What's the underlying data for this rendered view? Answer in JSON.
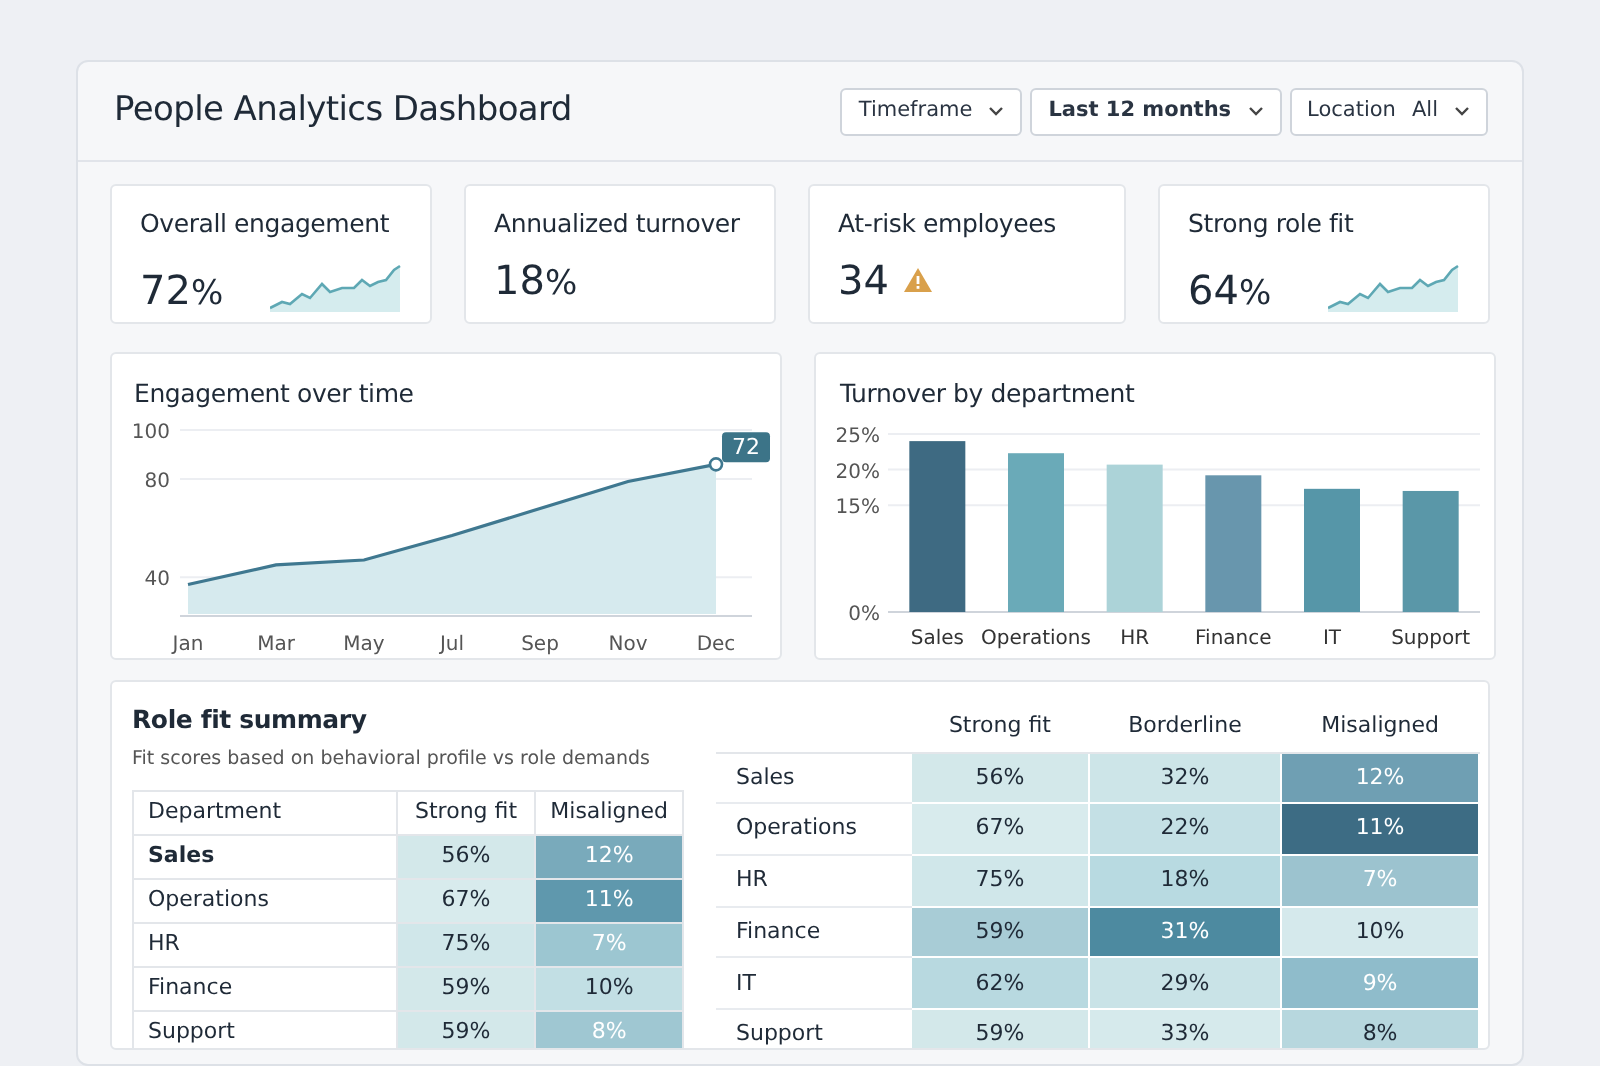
{
  "title": "People Analytics Dashboard",
  "filters": [
    {
      "label": "Timeframe",
      "bold": false
    },
    {
      "label": "Last 12 months",
      "bold": true
    },
    {
      "label": "Location",
      "value": "All",
      "bold": false
    }
  ],
  "kpis": [
    {
      "label": "Overall engagement",
      "value": "72",
      "unit": "%",
      "kind": "sparkline"
    },
    {
      "label": "Annualized turnover",
      "value": "18",
      "unit": "%",
      "kind": "plain"
    },
    {
      "label": "At-risk employees",
      "value": "34",
      "kind": "warning"
    },
    {
      "label": "Strong role fit",
      "value": "64",
      "unit": "%",
      "kind": "sparkline"
    }
  ],
  "engagement_chart": {
    "title": "Engagement over time",
    "chart_data": {
      "type": "area",
      "categories": [
        "Jan",
        "Mar",
        "May",
        "Jul",
        "Sep",
        "Nov",
        "Dec"
      ],
      "ylim": [
        25,
        100
      ],
      "yticks": [
        40,
        80,
        100
      ],
      "series": [
        {
          "color": "#3f7890",
          "values": [
            37,
            45,
            47,
            57,
            68,
            79,
            86
          ]
        }
      ],
      "annotations": [
        {
          "x": "Dec",
          "y": 86,
          "text": "72"
        }
      ]
    }
  },
  "turnover_chart": {
    "title": "Turnover by department",
    "chart_data": {
      "type": "bar",
      "categories": [
        "Sales",
        "Operations",
        "HR",
        "Finance",
        "IT",
        "Support"
      ],
      "ylim": [
        0,
        25
      ],
      "yticks": [
        {
          "value": 0,
          "label": "0%"
        },
        {
          "value": 15,
          "label": "15%"
        },
        {
          "value": 20,
          "label": "20%"
        },
        {
          "value": 25,
          "label": "25%"
        }
      ],
      "series": [
        {
          "values": [
            24,
            22.3,
            20.7,
            19.2,
            17.3,
            17
          ]
        }
      ],
      "colors": [
        "#3e6a82",
        "#6aaab8",
        "#acd3d8",
        "#6896ad",
        "#5696a8",
        "#5a97a8"
      ]
    }
  },
  "role_fit": {
    "title": "Role fit summary",
    "subtitle": "Fit scores based on behavioral profile vs role demands",
    "columns": [
      "Department",
      "Strong fit",
      "Misaligned"
    ],
    "rows": [
      {
        "selected": true,
        "cells": [
          {
            "text": "Sales"
          },
          {
            "text": "56%",
            "color": "#d3e8ea"
          },
          {
            "text": "12%",
            "color": "#79aabb"
          }
        ]
      },
      {
        "selected": false,
        "cells": [
          {
            "text": "Operations"
          },
          {
            "text": "67%",
            "color": "#d8ebed"
          },
          {
            "text": "11%",
            "color": "#5f98ad"
          }
        ]
      },
      {
        "selected": false,
        "cells": [
          {
            "text": "HR"
          },
          {
            "text": "75%",
            "color": "#d0e7ea"
          },
          {
            "text": "7%",
            "color": "#9cc6d1"
          }
        ]
      },
      {
        "selected": false,
        "cells": [
          {
            "text": "Finance"
          },
          {
            "text": "59%",
            "color": "#d3e8ea"
          },
          {
            "text": "10%",
            "color": "#c2dfe4"
          }
        ]
      },
      {
        "selected": false,
        "cells": [
          {
            "text": "Support"
          },
          {
            "text": "59%",
            "color": "#d3e8ea"
          },
          {
            "text": "8%",
            "color": "#9fc7d2"
          }
        ]
      }
    ]
  },
  "heatmap": {
    "columns": [
      "",
      "Strong fit",
      "Borderline",
      "Misaligned"
    ],
    "rows": [
      {
        "cells": [
          {
            "text": "Sales"
          },
          {
            "text": "56%",
            "color": "#d3e8ea"
          },
          {
            "text": "32%",
            "color": "#cde5e8"
          },
          {
            "text": "12%",
            "color": "#6f9fb3"
          }
        ]
      },
      {
        "cells": [
          {
            "text": "Operations"
          },
          {
            "text": "67%",
            "color": "#d8ebed"
          },
          {
            "text": "22%",
            "color": "#c4e0e5"
          },
          {
            "text": "11%",
            "color": "#3d6c84"
          }
        ]
      },
      {
        "cells": [
          {
            "text": "HR"
          },
          {
            "text": "75%",
            "color": "#d0e7ea"
          },
          {
            "text": "18%",
            "color": "#b8dae1"
          },
          {
            "text": "7%",
            "color": "#9cc3cf"
          }
        ]
      },
      {
        "cells": [
          {
            "text": "Finance"
          },
          {
            "text": "59%",
            "color": "#a8ccd6"
          },
          {
            "text": "31%",
            "color": "#4d8aa0"
          },
          {
            "text": "10%",
            "color": "#d5e9ec"
          }
        ]
      },
      {
        "cells": [
          {
            "text": "IT"
          },
          {
            "text": "62%",
            "color": "#b8d9e0"
          },
          {
            "text": "29%",
            "color": "#c9e3e7"
          },
          {
            "text": "9%",
            "color": "#8fbccb"
          }
        ]
      },
      {
        "cells": [
          {
            "text": "Support"
          },
          {
            "text": "59%",
            "color": "#d3e8ea"
          },
          {
            "text": "33%",
            "color": "#d6eaec"
          },
          {
            "text": "8%",
            "color": "#b7d7de"
          }
        ]
      }
    ]
  }
}
